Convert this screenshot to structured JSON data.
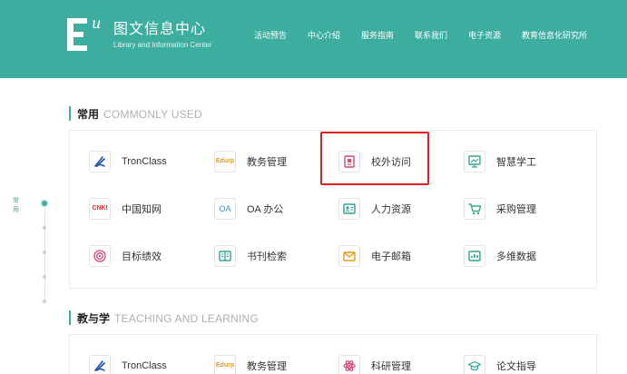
{
  "header": {
    "logo_letter": "u",
    "brand_cn": "图文信息中心",
    "brand_en": "Library and Information Center",
    "nav": [
      "活动预告",
      "中心介绍",
      "服务指南",
      "联系我们",
      "电子资源",
      "教育信息化研究所"
    ]
  },
  "sidebar": {
    "active_label": "常用"
  },
  "sections": [
    {
      "title_cn": "常用",
      "title_en": "COMMONLY USED",
      "items": [
        {
          "label": "TronClass",
          "icon": "tronclass-icon",
          "color": "#1d4ea8"
        },
        {
          "label": "教务管理",
          "icon": "edurp-icon",
          "icon_text": "Edurp",
          "color": "#e59a1a"
        },
        {
          "label": "校外访问",
          "icon": "document-icon",
          "color": "#d94a6e"
        },
        {
          "label": "智慧学工",
          "icon": "presentation-icon",
          "color": "#3aa58c"
        },
        {
          "label": "中国知网",
          "icon": "cnki-icon",
          "icon_text": "CNKI",
          "color": "#d9322f"
        },
        {
          "label": "OA 办公",
          "icon": "oa-icon",
          "icon_text": "OA",
          "color": "#2a8fd0"
        },
        {
          "label": "人力资源",
          "icon": "id-card-icon",
          "color": "#2fa38b"
        },
        {
          "label": "采购管理",
          "icon": "cart-icon",
          "color": "#3aa58c"
        },
        {
          "label": "目标绩效",
          "icon": "target-icon",
          "color": "#d9427a"
        },
        {
          "label": "书刊检索",
          "icon": "book-search-icon",
          "color": "#3aa58c"
        },
        {
          "label": "电子邮箱",
          "icon": "mail-icon",
          "color": "#e59a1a"
        },
        {
          "label": "多维数据",
          "icon": "data-icon",
          "color": "#2fa38b"
        }
      ]
    },
    {
      "title_cn": "教与学",
      "title_en": "TEACHING AND LEARNING",
      "items": [
        {
          "label": "TronClass",
          "icon": "tronclass-icon",
          "color": "#1d4ea8"
        },
        {
          "label": "教务管理",
          "icon": "edurp-icon",
          "icon_text": "Edurp",
          "color": "#e59a1a"
        },
        {
          "label": "科研管理",
          "icon": "atom-icon",
          "color": "#d9427a"
        },
        {
          "label": "论文指导",
          "icon": "graduation-icon",
          "color": "#2fa38b"
        }
      ]
    }
  ]
}
